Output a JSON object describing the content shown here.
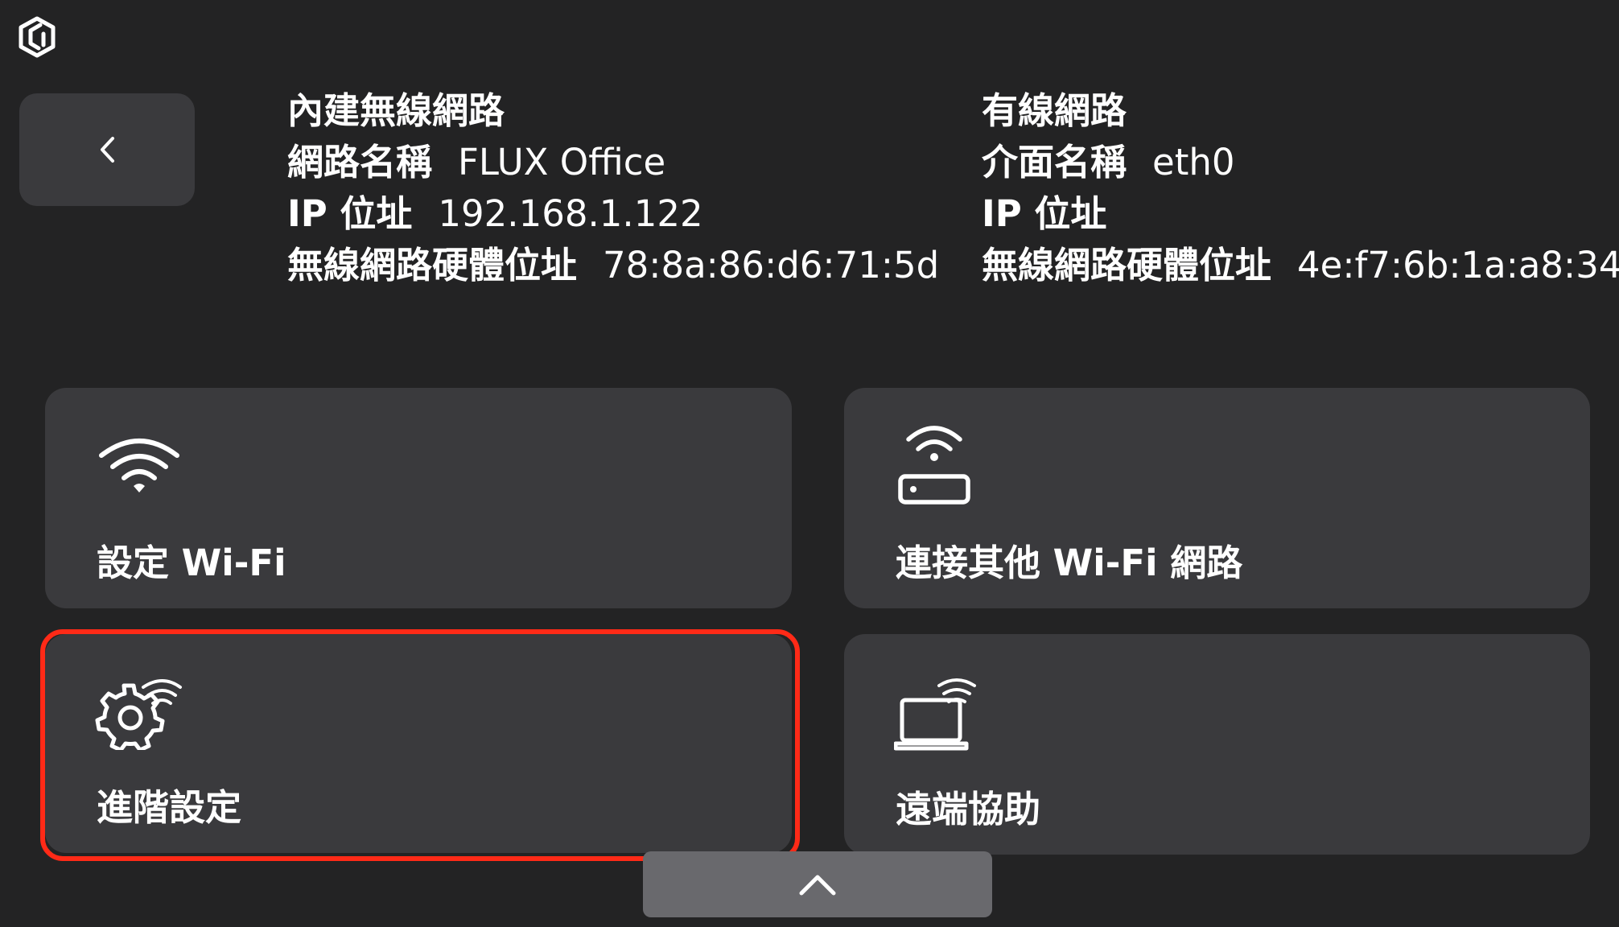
{
  "wireless": {
    "title": "內建無線網路",
    "ssid_label": "網路名稱",
    "ssid_value": "FLUX Office",
    "ip_label": "IP 位址",
    "ip_value": "192.168.1.122",
    "mac_label": "無線網路硬體位址",
    "mac_value": "78:8a:86:d6:71:5d"
  },
  "wired": {
    "title": "有線網路",
    "iface_label": "介面名稱",
    "iface_value": "eth0",
    "ip_label": "IP 位址",
    "mac_label": "無線網路硬體位址",
    "mac_value": "4e:f7:6b:1a:a8:34"
  },
  "cards": [
    {
      "label": "設定 Wi-Fi",
      "icon": "wifi-icon"
    },
    {
      "label": "連接其他 Wi-Fi 網路",
      "icon": "router-wifi-icon"
    },
    {
      "label": "進階設定",
      "icon": "gear-wifi-icon"
    },
    {
      "label": "遠端協助",
      "icon": "laptop-wifi-icon"
    }
  ],
  "icons": {
    "logo": "flux-logo-icon",
    "back": "chevron-left-icon",
    "collapse": "chevron-up-icon"
  },
  "colors": {
    "background": "#232324",
    "card": "#3a3a3d",
    "collapse_button": "#69696d",
    "highlight": "#ff2a17"
  }
}
